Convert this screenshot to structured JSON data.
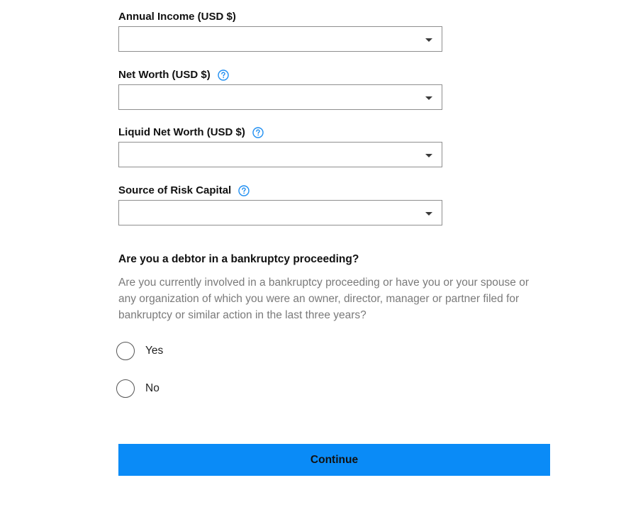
{
  "fields": [
    {
      "label": "Annual Income (USD $)",
      "has_help": false,
      "value": ""
    },
    {
      "label": "Net Worth (USD $)",
      "has_help": true,
      "value": ""
    },
    {
      "label": "Liquid Net Worth (USD $)",
      "has_help": true,
      "value": ""
    },
    {
      "label": "Source of Risk Capital",
      "has_help": true,
      "value": ""
    }
  ],
  "bankruptcy": {
    "question": "Are you a debtor in a bankruptcy proceeding?",
    "description": "Are you currently involved in a bankruptcy proceeding or have you or your spouse or any organization of which you were an owner, director, manager or partner filed for bankruptcy or similar action in the last three years?",
    "options": [
      {
        "label": "Yes",
        "selected": false
      },
      {
        "label": "No",
        "selected": false
      }
    ]
  },
  "continue_label": "Continue",
  "colors": {
    "accent": "#0a8bf7",
    "help_icon": "#1f8ef1",
    "description_text": "#7a7a7a"
  },
  "icons": {
    "help": "question-circle-icon",
    "dropdown": "caret-down-icon"
  }
}
